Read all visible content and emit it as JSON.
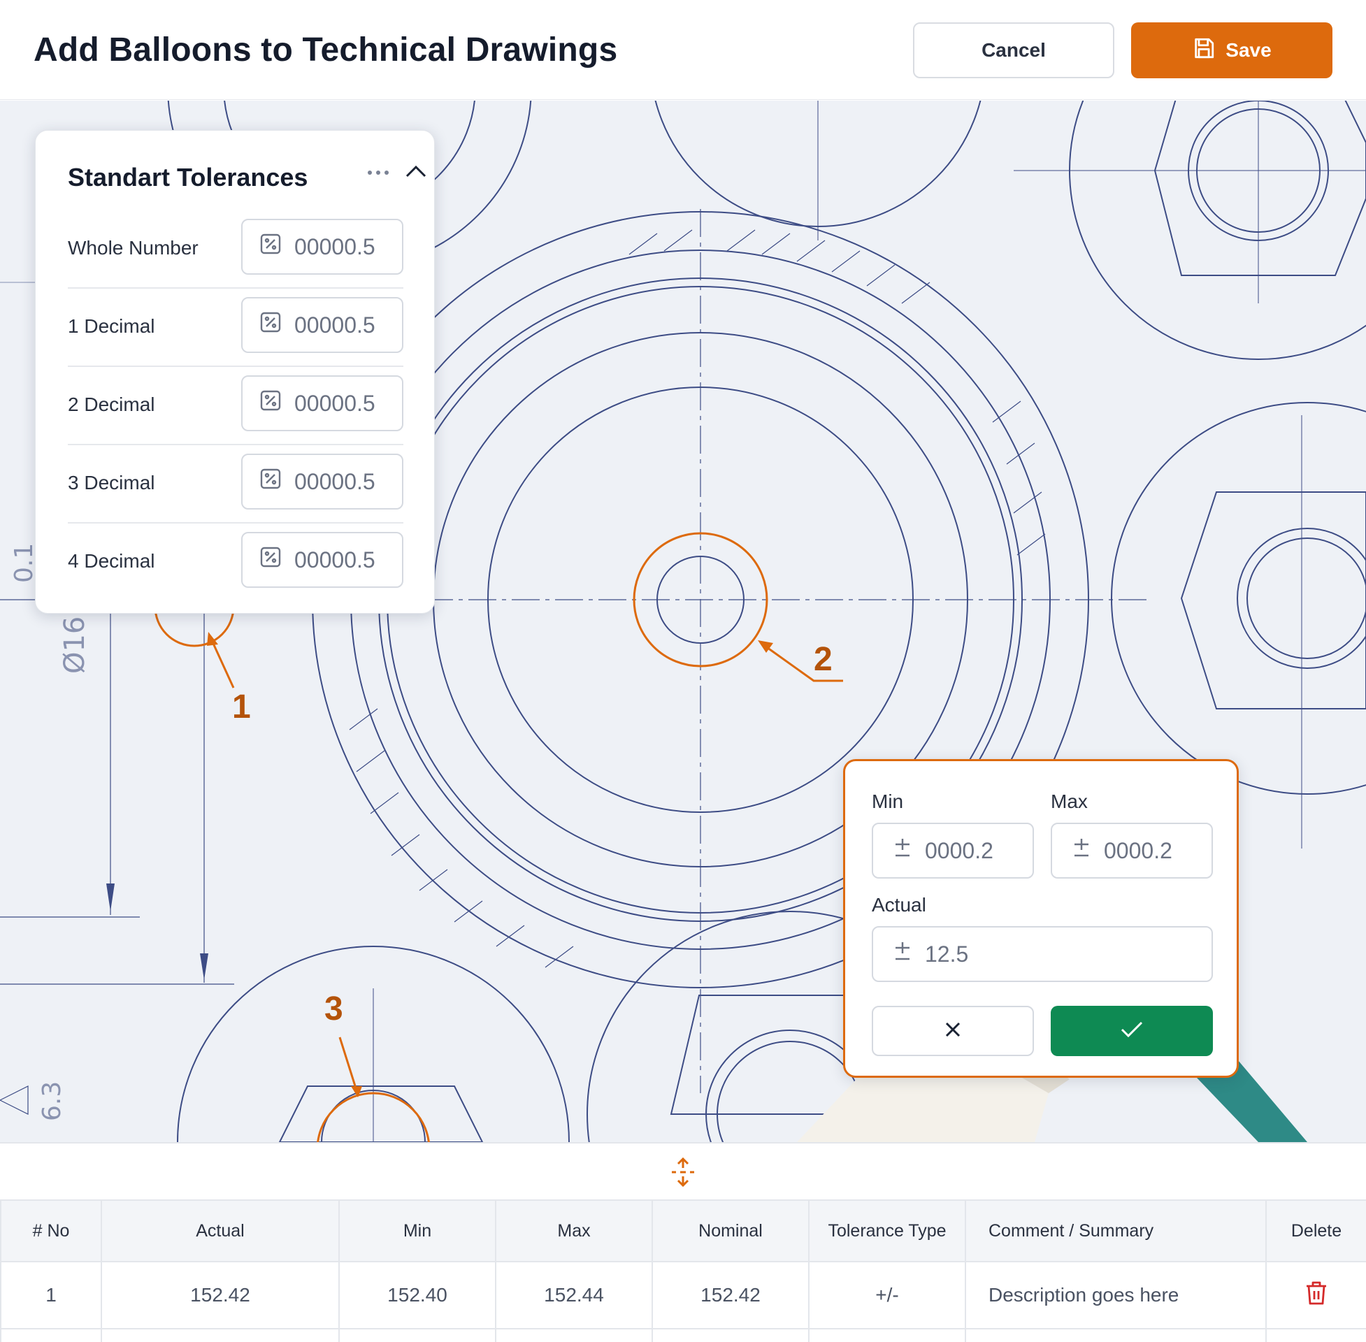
{
  "header": {
    "title": "Add Balloons to Technical Drawings",
    "cancel_label": "Cancel",
    "save_label": "Save"
  },
  "tolerances": {
    "title": "Standart Tolerances",
    "rows": [
      {
        "label": "Whole Number",
        "value": "00000.5"
      },
      {
        "label": "1 Decimal",
        "value": "00000.5"
      },
      {
        "label": "2 Decimal",
        "value": "00000.5"
      },
      {
        "label": "3 Decimal",
        "value": "00000.5"
      },
      {
        "label": "4 Decimal",
        "value": "00000.5"
      }
    ]
  },
  "balloons": [
    "1",
    "2",
    "3"
  ],
  "popup": {
    "min_label": "Min",
    "max_label": "Max",
    "actual_label": "Actual",
    "min_value": "0000.2",
    "max_value": "0000.2",
    "actual_value": "12.5"
  },
  "table": {
    "headers": [
      "# No",
      "Actual",
      "Min",
      "Max",
      "Nominal",
      "Tolerance Type",
      "Comment / Summary",
      "Delete"
    ],
    "rows": [
      {
        "no": "1",
        "actual": "152.42",
        "min": "152.40",
        "max": "152.44",
        "nominal": "152.42",
        "tolerance_type": "+/-",
        "comment": "Description goes here"
      }
    ]
  },
  "drawing_labels": {
    "dim_a": "Ø16",
    "dim_b": "0.1",
    "dim_c": "6.3"
  },
  "colors": {
    "accent": "#dd6a0d",
    "confirm": "#0e8a53",
    "delete": "#d42a2a",
    "line": "#3d4c85"
  }
}
